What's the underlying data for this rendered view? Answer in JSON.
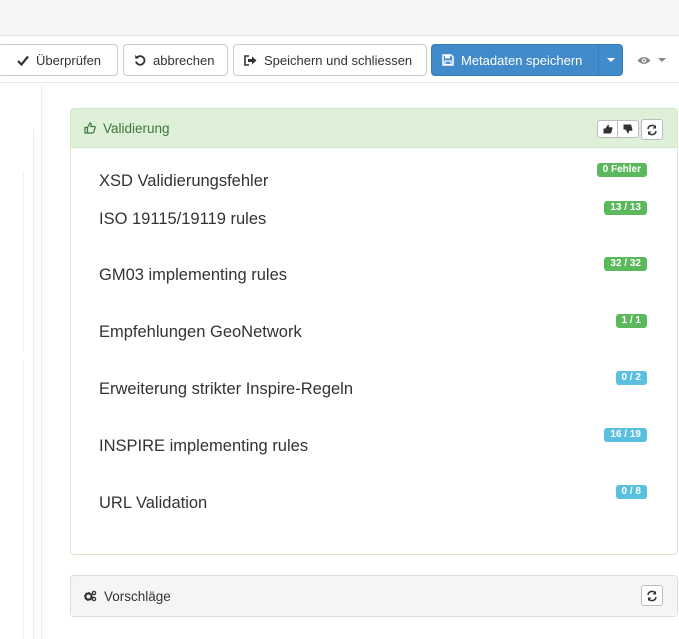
{
  "toolbar": {
    "check_label": "Überprüfen",
    "cancel_label": "abbrechen",
    "save_close_label": "Speichern und schliessen",
    "save_metadata_label": "Metadaten speichern"
  },
  "validation": {
    "title": "Validierung",
    "rows": [
      {
        "label": "XSD Validierungsfehler",
        "badge": "0 Fehler",
        "status": "success"
      },
      {
        "label": "ISO 19115/19119 rules",
        "badge": "13 / 13",
        "status": "success"
      },
      {
        "label": "GM03 implementing rules",
        "badge": "32 / 32",
        "status": "success"
      },
      {
        "label": "Empfehlungen GeoNetwork",
        "badge": "1 / 1",
        "status": "success"
      },
      {
        "label": "Erweiterung strikter Inspire-Regeln",
        "badge": "0 / 2",
        "status": "info"
      },
      {
        "label": "INSPIRE implementing rules",
        "badge": "16 / 19",
        "status": "info"
      },
      {
        "label": "URL Validation",
        "badge": "0 / 8",
        "status": "info"
      }
    ]
  },
  "suggestions": {
    "title": "Vorschläge"
  },
  "colors": {
    "primary": "#428bca",
    "success": "#5cb85c",
    "info": "#5bc0de",
    "validation_header_bg": "#dff0d8",
    "validation_header_text": "#3c763d"
  }
}
